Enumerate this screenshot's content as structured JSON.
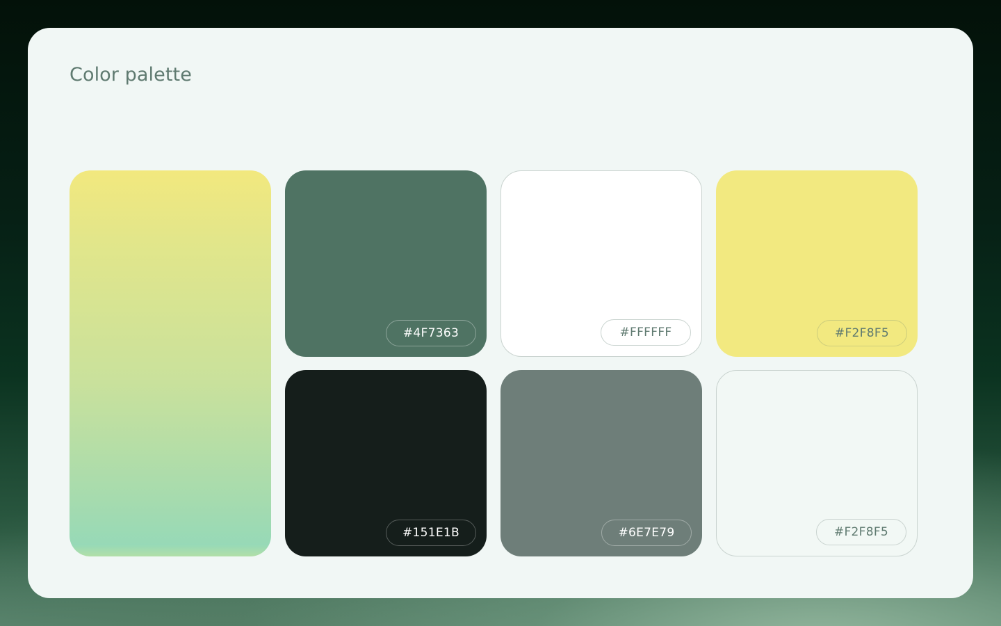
{
  "title": "Color palette",
  "gradient": {
    "from_color": "#F2E87E",
    "to_color": "#97D9B7"
  },
  "swatches": [
    {
      "hex_label": "#4F7363",
      "fill": "#4F7363",
      "chip_text_color": "#FFFFFF",
      "chip_border": "rgba(255,255,255,0.35)"
    },
    {
      "hex_label": "#FFFFFF",
      "fill": "#FFFFFF",
      "chip_text_color": "#5F7A70",
      "chip_border": "#C9D3CF"
    },
    {
      "hex_label": "#F2F8F5",
      "fill": "#F2E980",
      "chip_text_color": "#5F7A70",
      "chip_border": "rgba(95,122,112,0.25)"
    },
    {
      "hex_label": "#151E1B",
      "fill": "#151E1B",
      "chip_text_color": "#FFFFFF",
      "chip_border": "rgba(255,255,255,0.28)"
    },
    {
      "hex_label": "#6E7E79",
      "fill": "#6E7E79",
      "chip_text_color": "#FFFFFF",
      "chip_border": "rgba(255,255,255,0.35)"
    },
    {
      "hex_label": "#F2F8F5",
      "fill": "#F2F8F5",
      "chip_text_color": "#5F7A70",
      "chip_border": "#C9D3CF"
    }
  ]
}
